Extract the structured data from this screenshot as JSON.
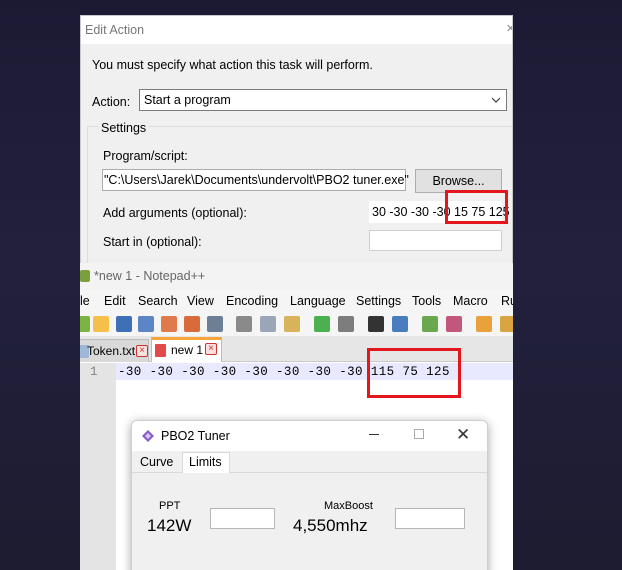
{
  "edit_action": {
    "title": "Edit Action",
    "close_glyph": "×",
    "instruction": "You must specify what action this task will perform.",
    "action_label": "Action:",
    "action_value": "Start a program",
    "settings_legend": "Settings",
    "program_label": "Program/script:",
    "program_value": "\"C:\\Users\\Jarek\\Documents\\undervolt\\PBO2 tuner.exe\"",
    "browse_label": "Browse...",
    "args_label": "Add arguments (optional):",
    "args_value": "30 -30 -30 -30  15 75 125",
    "startin_label": "Start in (optional):"
  },
  "notepad": {
    "title": "*new 1 - Notepad++",
    "menu": [
      "le",
      "Edit",
      "Search",
      "View",
      "Encoding",
      "Language",
      "Settings",
      "Tools",
      "Macro",
      "Ru"
    ],
    "tabs": [
      {
        "label": "Token.txt",
        "close": "×"
      },
      {
        "label": "new 1",
        "close": "×"
      }
    ],
    "line_number": "1",
    "line_text": "-30 -30 -30 -30 -30 -30 -30 -30 115 75 125"
  },
  "pbo2": {
    "title": "PBO2 Tuner",
    "close_glyph": "✕",
    "tabs": [
      "Curve",
      "Limits"
    ],
    "selected_tab": "Limits",
    "ppt_label": "PPT",
    "ppt_value": "142W",
    "maxboost_label": "MaxBoost",
    "maxboost_value": "4,550mhz"
  },
  "colors": {
    "highlight": "#e3161d",
    "background": "#1c1a33",
    "npp_tab_accent": "#f7a43a",
    "current_line": "#e8e8ff"
  }
}
